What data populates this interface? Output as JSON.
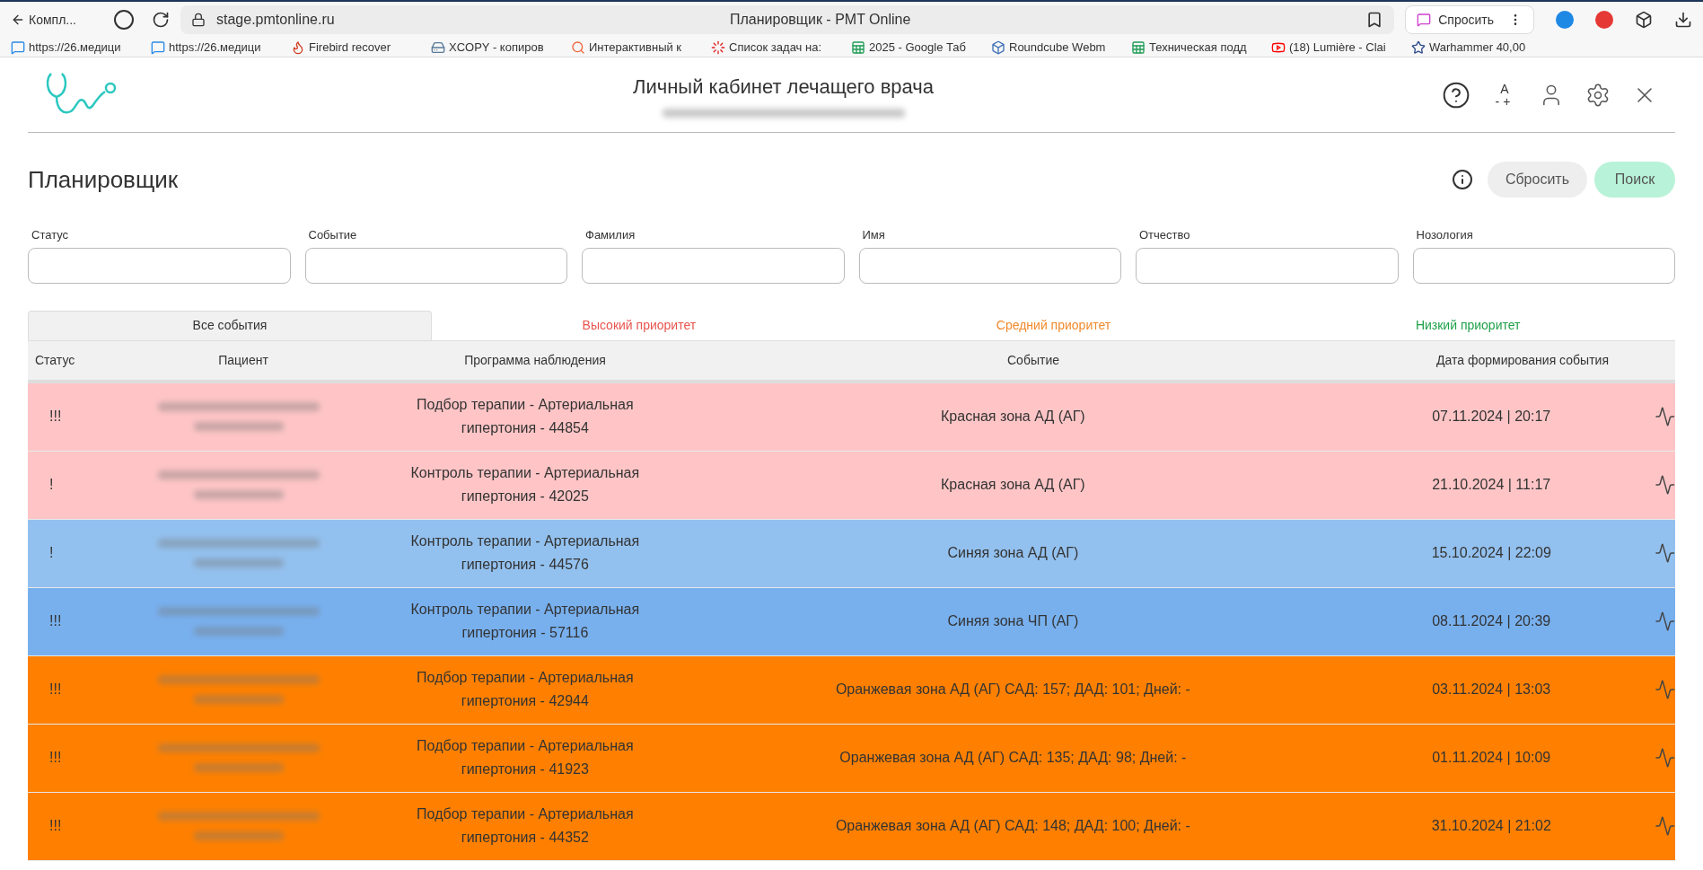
{
  "browser": {
    "back_label": "Компл...",
    "url": "stage.pmtonline.ru",
    "title": "Планировщик - PMT Online",
    "ask_label": "Спросить",
    "bookmarks": [
      {
        "label": "https://26.медици"
      },
      {
        "label": "https://26.медици"
      },
      {
        "label": "Firebird recover"
      },
      {
        "label": "XCOPY - копиров"
      },
      {
        "label": "Интерактивный к"
      },
      {
        "label": "Список задач на:"
      },
      {
        "label": "2025 - Google Таб"
      },
      {
        "label": "Roundcube Webm"
      },
      {
        "label": "Техническая подд"
      },
      {
        "label": "(18) Lumière - Clai"
      },
      {
        "label": "Warhammer 40,00"
      }
    ]
  },
  "header": {
    "title": "Личный кабинет лечащего врача",
    "font_small": "A",
    "font_minus": "-",
    "font_plus": "+"
  },
  "page": {
    "title": "Планировщик",
    "reset_button": "Сбросить",
    "search_button": "Поиск"
  },
  "filters": [
    {
      "label": "Статус"
    },
    {
      "label": "Событие"
    },
    {
      "label": "Фамилия"
    },
    {
      "label": "Имя"
    },
    {
      "label": "Отчество"
    },
    {
      "label": "Нозология"
    }
  ],
  "tabs": [
    {
      "label": "Все события",
      "selected": true,
      "color": "#333333"
    },
    {
      "label": "Высокий приоритет",
      "selected": false,
      "color": "#e8544e"
    },
    {
      "label": "Средний приоритет",
      "selected": false,
      "color": "#f08a2c"
    },
    {
      "label": "Низкий приоритет",
      "selected": false,
      "color": "#1fa14a"
    }
  ],
  "table": {
    "columns": [
      "Статус",
      "Пациент",
      "Программа наблюдения",
      "Событие",
      "Дата формирования события"
    ],
    "rows": [
      {
        "status": "!!!",
        "program": "Подбор терапии - Артериальная гипертония - 44854",
        "event": "Красная зона АД (АГ)",
        "date": "07.11.2024 | 20:17",
        "color": "#ffc5c6"
      },
      {
        "status": "!",
        "program": "Контроль терапии - Артериальная гипертония - 42025",
        "event": "Красная зона АД (АГ)",
        "date": "21.10.2024 | 11:17",
        "color": "#ffc5c6"
      },
      {
        "status": "!",
        "program": "Контроль терапии - Артериальная гипертония - 44576",
        "event": "Синяя зона АД (АГ)",
        "date": "15.10.2024 | 22:09",
        "color": "#93c1ef"
      },
      {
        "status": "!!!",
        "program": "Контроль терапии - Артериальная гипертония - 57116",
        "event": "Синяя зона ЧП (АГ)",
        "date": "08.11.2024 | 20:39",
        "color": "#78b0ee"
      },
      {
        "status": "!!!",
        "program": "Подбор терапии - Артериальная гипертония - 42944",
        "event": "Оранжевая зона АД (АГ) САД: 157; ДАД: 101; Дней: -",
        "date": "03.11.2024 | 13:03",
        "color": "#ff8000"
      },
      {
        "status": "!!!",
        "program": "Подбор терапии - Артериальная гипертония - 41923",
        "event": "Оранжевая зона АД (АГ) САД: 135; ДАД: 98; Дней: -",
        "date": "01.11.2024 | 10:09",
        "color": "#ff8000"
      },
      {
        "status": "!!!",
        "program": "Подбор терапии - Артериальная гипертония - 44352",
        "event": "Оранжевая зона АД (АГ) САД: 148; ДАД: 100; Дней: -",
        "date": "31.10.2024 | 21:02",
        "color": "#ff8000"
      }
    ]
  }
}
